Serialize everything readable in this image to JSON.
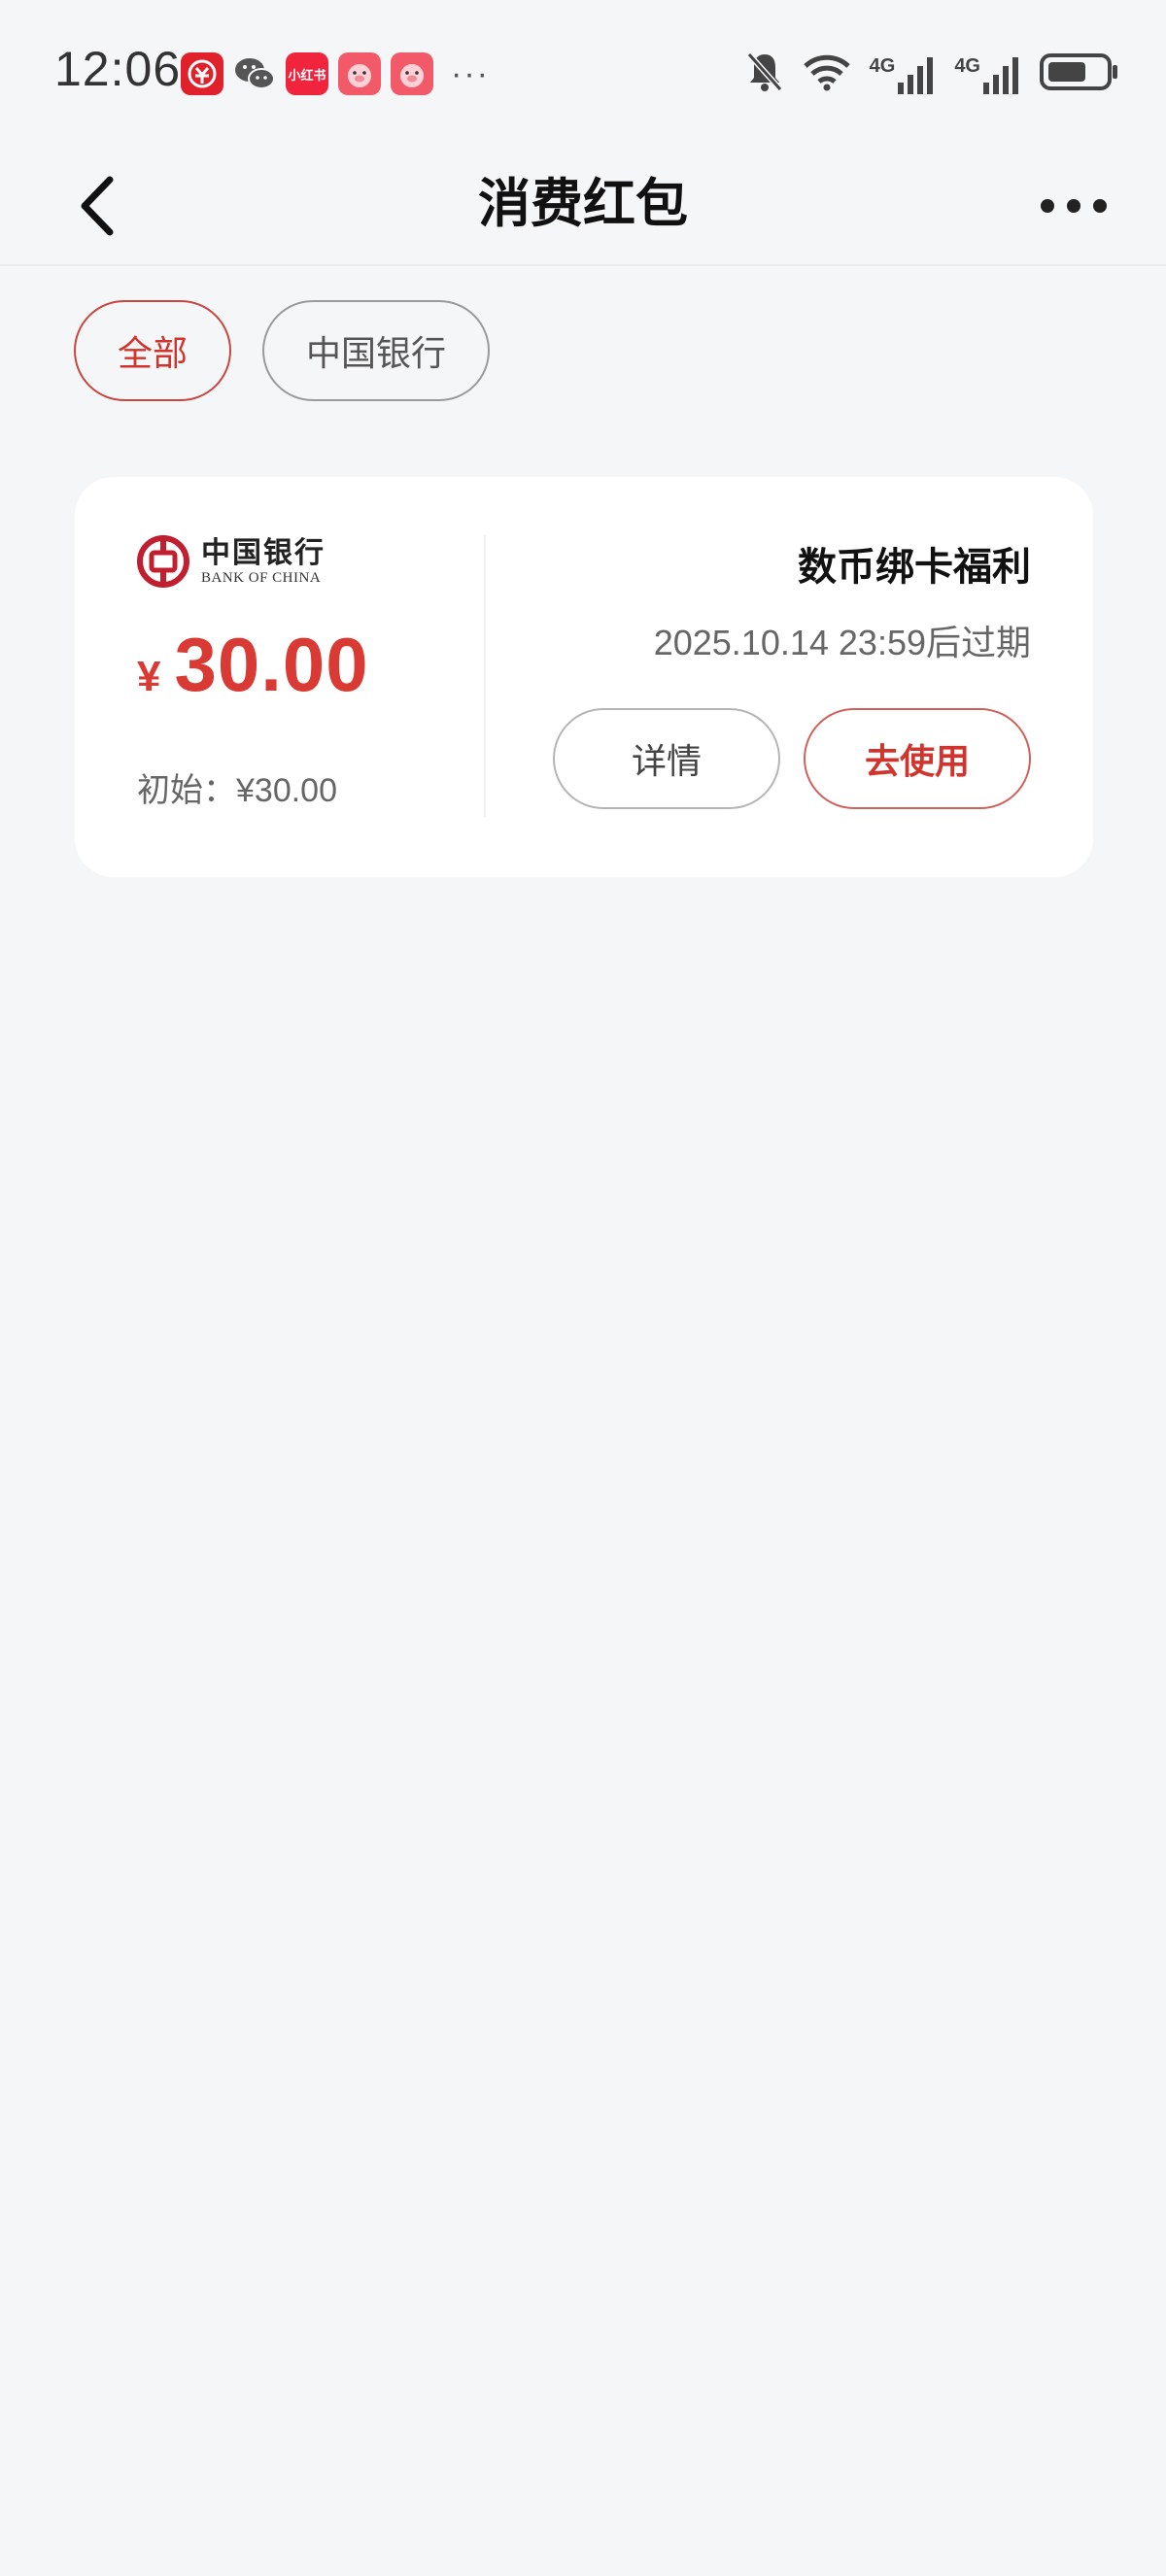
{
  "status_bar": {
    "time": "12:06",
    "more": "···",
    "notification_icons": [
      "ecny-app-icon",
      "wechat-icon",
      "xiaohongshu-icon",
      "pig-app-icon",
      "pig-app-icon"
    ],
    "xiaohongshu_label": "小红书",
    "signal_1": "4G",
    "signal_2": "4G"
  },
  "header": {
    "title": "消费红包"
  },
  "filters": [
    {
      "label": "全部",
      "active": true
    },
    {
      "label": "中国银行",
      "active": false
    }
  ],
  "coupon": {
    "bank_name_cn": "中国银行",
    "bank_name_en": "BANK OF CHINA",
    "currency_symbol": "¥",
    "amount": "30.00",
    "initial_label": "初始：¥30.00",
    "title": "数币绑卡福利",
    "expiry": "2025.10.14 23:59后过期",
    "details_label": "详情",
    "use_label": "去使用"
  },
  "colors": {
    "accent": "#d0342c",
    "background": "#f5f6f8",
    "card": "#ffffff"
  }
}
